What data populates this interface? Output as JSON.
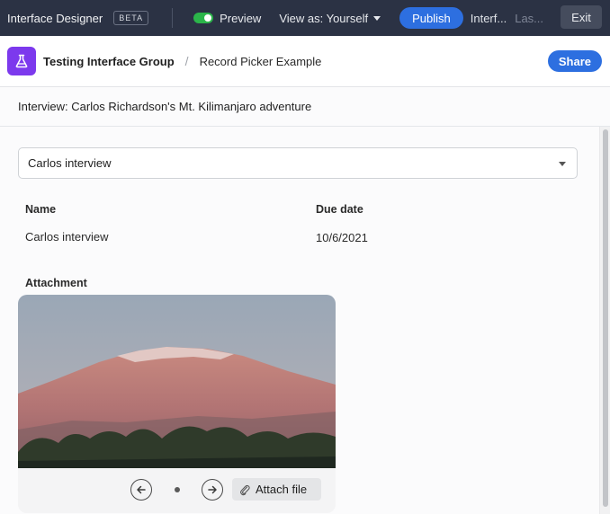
{
  "topbar": {
    "app_title": "Interface Designer",
    "beta_badge": "BETA",
    "preview_label": "Preview",
    "view_as_label": "View as: Yourself",
    "publish_label": "Publish",
    "interface_truncated": "Interf...",
    "last_truncated": "Las...",
    "exit_label": "Exit",
    "preview_toggle_on": true
  },
  "header": {
    "app_icon": "flask-icon",
    "group_name": "Testing Interface Group",
    "breadcrumb_separator": "/",
    "page_name": "Record Picker Example",
    "share_label": "Share"
  },
  "record": {
    "title": "Interview: Carlos Richardson's Mt. Kilimanjaro adventure"
  },
  "picker": {
    "selected_value": "Carlos interview"
  },
  "fields": {
    "name_label": "Name",
    "name_value": "Carlos interview",
    "due_date_label": "Due date",
    "due_date_value": "10/6/2021",
    "attachment_label": "Attachment"
  },
  "attachment": {
    "attach_button_label": "Attach file",
    "prev_icon": "arrow-left-icon",
    "next_icon": "arrow-right-icon"
  },
  "colors": {
    "topbar_bg": "#2b3244",
    "accent_blue": "#2d6fe0",
    "app_icon_purple": "#7c39ed",
    "toggle_green": "#2bb54a"
  }
}
